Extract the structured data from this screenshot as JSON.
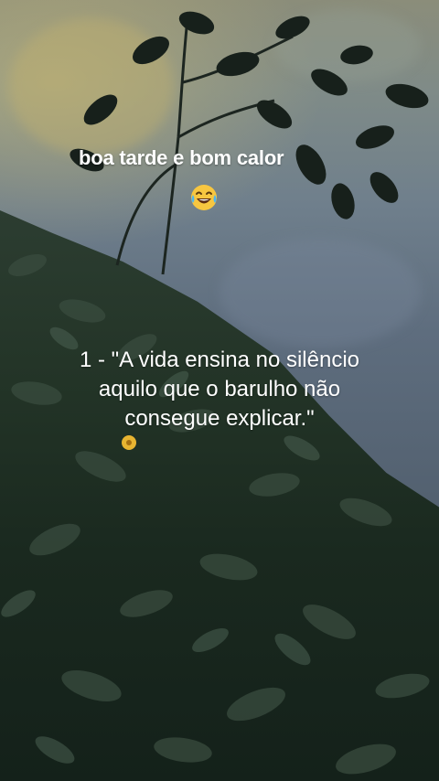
{
  "greeting": {
    "text": "boa tarde e bom calor",
    "emoji": "😂",
    "emoji_icon": "laughing-tears-icon"
  },
  "quote": {
    "lines": [
      "1 - \"A vida ensina no silêncio",
      "aquilo que o barulho não",
      "consegue explicar.\""
    ]
  },
  "colors": {
    "water": "#6f7f8c",
    "foliage": "#233427",
    "text": "#ffffff",
    "flower": "#e8b431"
  }
}
